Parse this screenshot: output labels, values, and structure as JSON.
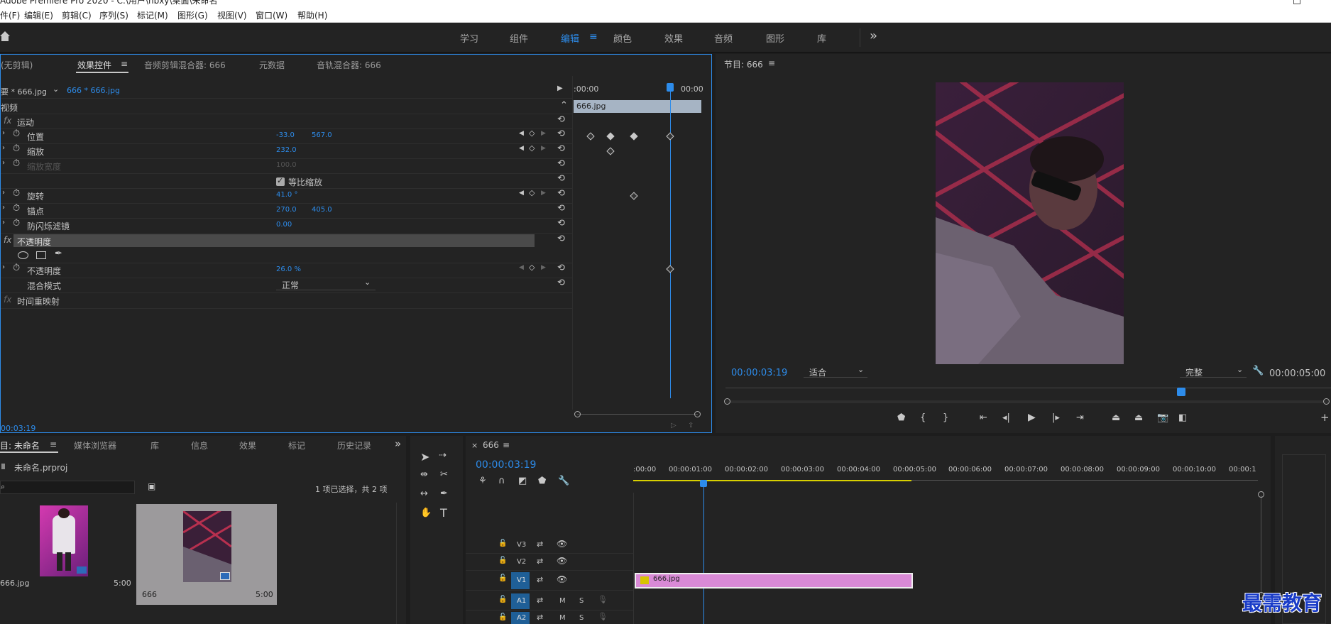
{
  "app_title": "Adobe Premiere Pro 2020 - C:\\用户\\hbxy\\桌面\\未命名",
  "menu": [
    "件(F)",
    "编辑(E)",
    "剪辑(C)",
    "序列(S)",
    "标记(M)",
    "图形(G)",
    "视图(V)",
    "窗口(W)",
    "帮助(H)"
  ],
  "workspaces": [
    "学习",
    "组件",
    "编辑",
    "颜色",
    "效果",
    "音频",
    "图形",
    "库"
  ],
  "more_glyph": "»",
  "fx_panel": {
    "tabs": [
      "(无剪辑)",
      "效果控件",
      "音频剪辑混合器: 666",
      "元数据",
      "音轨混合器: 666"
    ],
    "master_clip": "要 * 666.jpg",
    "seq_clip": "666 * 666.jpg",
    "ruler_start": ":00:00",
    "ruler_end": "00:00",
    "clip_bar": "666.jpg",
    "video_header": "视频",
    "motion": "运动",
    "props": [
      {
        "name": "位置",
        "v1": "-33.0",
        "v2": "567.0"
      },
      {
        "name": "缩放",
        "v1": "232.0",
        "v2": ""
      },
      {
        "name": "缩放宽度",
        "v1": "100.0",
        "v2": ""
      },
      {
        "name": "旋转",
        "v1": "41.0 °",
        "v2": ""
      },
      {
        "name": "锚点",
        "v1": "270.0",
        "v2": "405.0"
      },
      {
        "name": "防闪烁滤镜",
        "v1": "0.00",
        "v2": ""
      }
    ],
    "uniform_scale": "等比缩放",
    "opacity_header": "不透明度",
    "opacity_prop": "不透明度",
    "opacity_val": "26.0 %",
    "blend_label": "混合模式",
    "blend_val": "正常",
    "time_remap": "时间重映射",
    "timecode": "00:03:19"
  },
  "program": {
    "title": "节目: 666",
    "timecode": "00:00:03:19",
    "fit": "适合",
    "quality": "完整",
    "duration": "00:00:05:00"
  },
  "project": {
    "tabs": [
      "目: 未命名",
      "媒体浏览器",
      "库",
      "信息",
      "效果",
      "标记",
      "历史记录"
    ],
    "file": "未命名.prproj",
    "selection": "1 项已选择，共 2 项",
    "items": [
      {
        "name": "666.jpg",
        "dur": "5:00"
      },
      {
        "name": "666",
        "dur": "5:00"
      }
    ]
  },
  "timeline": {
    "tab": "666",
    "timecode": "00:00:03:19",
    "ticks": [
      ":00:00",
      "00:00:01:00",
      "00:00:02:00",
      "00:00:03:00",
      "00:00:04:00",
      "00:00:05:00",
      "00:00:06:00",
      "00:00:07:00",
      "00:00:08:00",
      "00:00:09:00",
      "00:00:10:00",
      "00:00:1"
    ],
    "tracks": [
      "V3",
      "V2",
      "V1",
      "A1",
      "A2"
    ],
    "track_m": "M",
    "track_s": "S",
    "clip": "666.jpg"
  },
  "watermark": "最需教育",
  "colors": {
    "accent": "#2d8ceb",
    "clip": "#d98ad6",
    "panel": "#232323"
  }
}
